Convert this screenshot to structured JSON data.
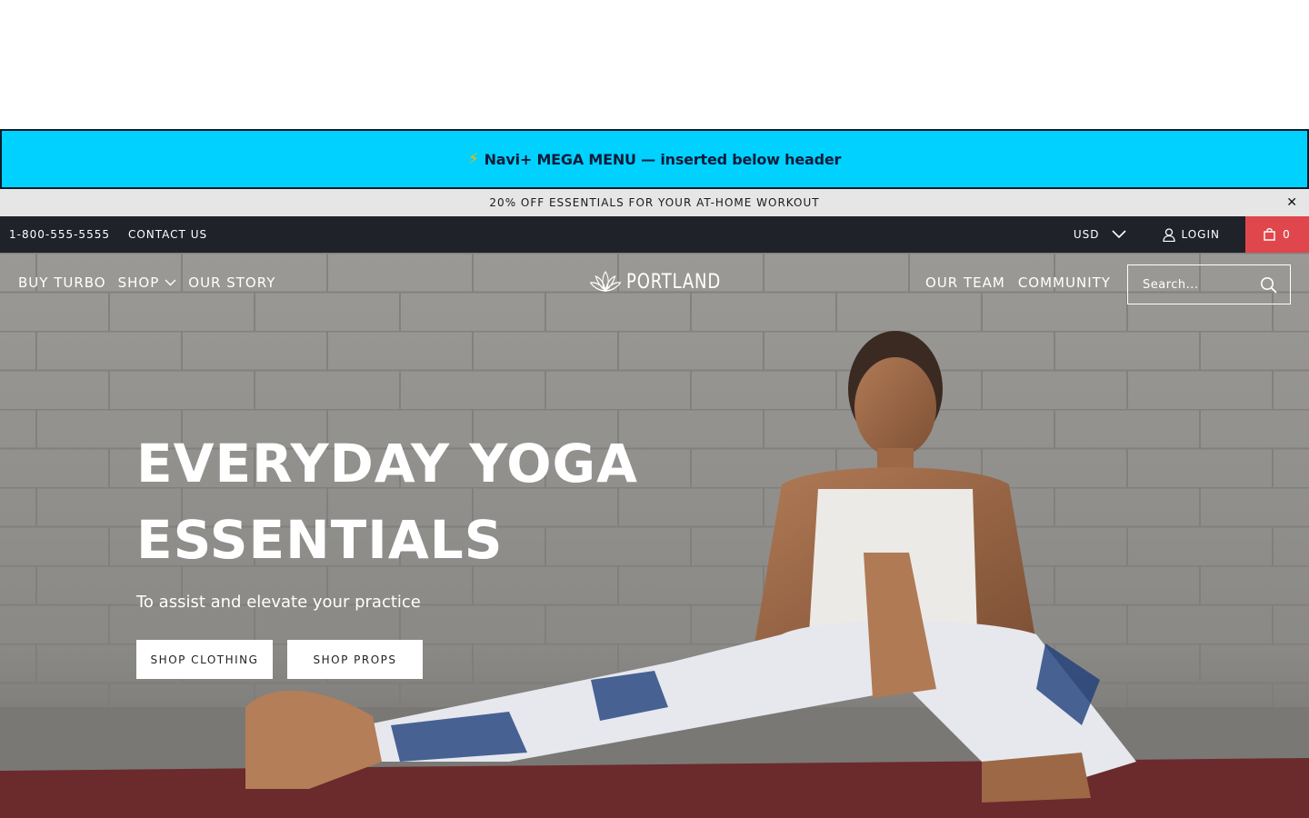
{
  "mega_banner": {
    "icon": "lightning-bolt-icon",
    "text": "Navi+ MEGA MENU — inserted below header"
  },
  "promo": {
    "text": "20% OFF ESSENTIALS FOR YOUR AT-HOME WORKOUT",
    "close": "✕"
  },
  "utility": {
    "phone": "1-800-555-5555",
    "contact": "CONTACT US",
    "currency": "USD",
    "login": "LOGIN",
    "cart_count": "0"
  },
  "nav": {
    "left": [
      {
        "label": "BUY TURBO"
      },
      {
        "label": "SHOP"
      },
      {
        "label": "OUR STORY"
      }
    ],
    "logo": "PORTLAND",
    "right": [
      {
        "label": "OUR TEAM"
      },
      {
        "label": "COMMUNITY"
      }
    ],
    "search_placeholder": "Search..."
  },
  "hero": {
    "title_line1": "EVERYDAY YOGA",
    "title_line2": "ESSENTIALS",
    "subtitle": "To assist and elevate your practice",
    "btn_clothing": "SHOP CLOTHING",
    "btn_props": "SHOP PROPS"
  },
  "colors": {
    "mega_banner_bg": "#00d1ff",
    "promo_bg": "#e6e6e6",
    "utility_bg": "#1f2229",
    "cart_bg": "#e0474c"
  }
}
